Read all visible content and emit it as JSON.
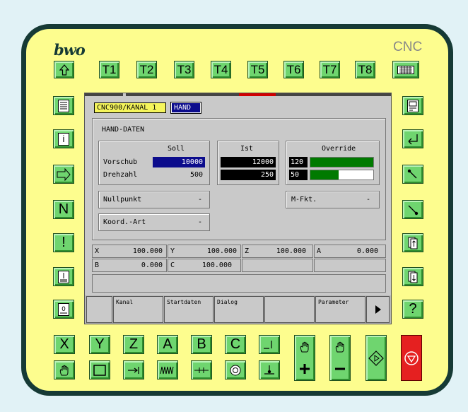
{
  "brand": {
    "logo": "bwo",
    "cnc": "CNC"
  },
  "top_keys": [
    "T1",
    "T2",
    "T3",
    "T4",
    "T5",
    "T6",
    "T7",
    "T8"
  ],
  "left_keys": [
    "i",
    "N",
    "!"
  ],
  "right_keys": [
    "?"
  ],
  "axis_keys": [
    "X",
    "Y",
    "Z",
    "A",
    "B",
    "C"
  ],
  "screen": {
    "channel_label": "CNC900/KANAL 1",
    "mode_label": "HAND",
    "section_title": "HAND-DATEN",
    "soll_header": "Soll",
    "ist_header": "Ist",
    "override_header": "Override",
    "rows": [
      {
        "label": "Vorschub",
        "soll": "10000",
        "ist": "12000"
      },
      {
        "label": "Drehzahl",
        "soll": "500",
        "ist": "250"
      }
    ],
    "override": [
      {
        "value": "120",
        "level": 1.0
      },
      {
        "value": "50",
        "level": 0.45
      }
    ],
    "nullpunkt": {
      "label": "Nullpunkt",
      "value": "-"
    },
    "mfkt": {
      "label": "M-Fkt.",
      "value": "-"
    },
    "koordart": {
      "label": "Koord.-Art",
      "value": "-"
    },
    "axes_row1": [
      {
        "axis": "X",
        "value": "100.000"
      },
      {
        "axis": "Y",
        "value": "100.000"
      },
      {
        "axis": "Z",
        "value": "100.000"
      },
      {
        "axis": "A",
        "value": "0.000"
      }
    ],
    "axes_row2": [
      {
        "axis": "B",
        "value": "0.000"
      },
      {
        "axis": "C",
        "value": "100.000"
      }
    ],
    "softkeys": [
      "",
      "Kanal",
      "Startdaten",
      "Dialog",
      "",
      "Parameter"
    ]
  },
  "colors": {
    "panel": "#fdfd8e",
    "frame": "#163a35",
    "key_green": "#6fd56f",
    "stop_red": "#e52020",
    "soll_highlight": "#0c0c8c",
    "override_bar": "#007a00"
  }
}
